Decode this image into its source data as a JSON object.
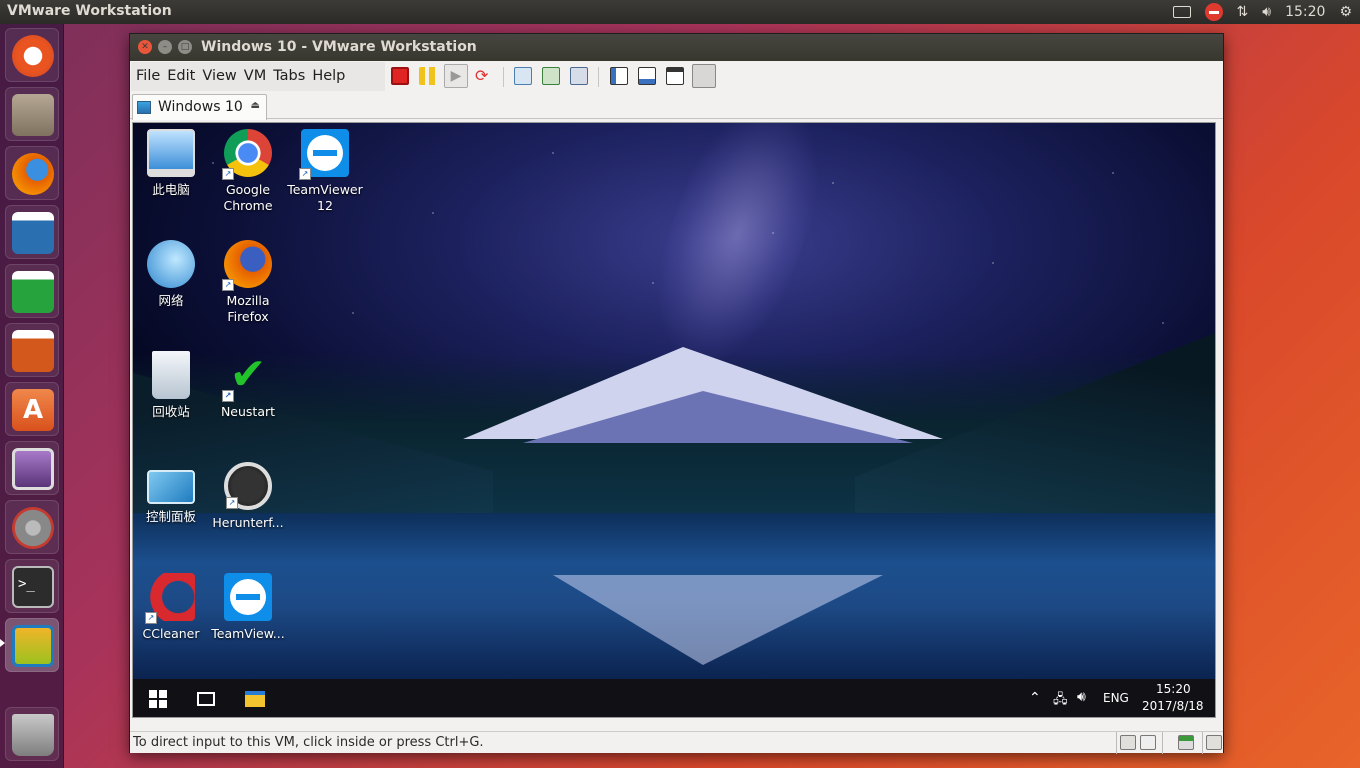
{
  "topbar": {
    "app_title": "VMware Workstation",
    "clock": "15:20",
    "icons": [
      "keyboard-layout-icon",
      "no-entry-icon",
      "network-arrows-icon",
      "volume-icon",
      "gear-icon"
    ]
  },
  "launcher": {
    "items": [
      {
        "name": "ubuntu-dash",
        "color": "#e95420"
      },
      {
        "name": "files",
        "color": "#9a8a76"
      },
      {
        "name": "firefox",
        "color": "#e66000"
      },
      {
        "name": "libreoffice-writer",
        "color": "#2a6fb0"
      },
      {
        "name": "libreoffice-calc",
        "color": "#27a33d"
      },
      {
        "name": "libreoffice-impress",
        "color": "#d2581b"
      },
      {
        "name": "ubuntu-software",
        "color": "#e76d2e"
      },
      {
        "name": "remote-desktop",
        "color": "#7b4f9e"
      },
      {
        "name": "system-settings",
        "color": "#c53b2f"
      },
      {
        "name": "terminal",
        "color": "#2c2c2c"
      },
      {
        "name": "vmware-workstation",
        "color": "#f0b429"
      },
      {
        "name": "trash",
        "color": "#8a8a8a"
      }
    ]
  },
  "window": {
    "title": "Windows 10 - VMware Workstation",
    "menus": [
      "File",
      "Edit",
      "View",
      "VM",
      "Tabs",
      "Help"
    ],
    "tab_label": "Windows 10",
    "status_message": "To direct input to this VM, click inside or press Ctrl+G."
  },
  "guest": {
    "desktop_icons": [
      {
        "label": "此电脑",
        "icon": "this-pc-icon"
      },
      {
        "label": "Google Chrome",
        "icon": "chrome-icon"
      },
      {
        "label": "TeamViewer 12",
        "icon": "teamviewer-icon"
      },
      {
        "label": "网络",
        "icon": "network-globe-icon"
      },
      {
        "label": "Mozilla Firefox",
        "icon": "firefox-icon"
      },
      {
        "label": "回收站",
        "icon": "recycle-bin-icon"
      },
      {
        "label": "Neustart",
        "icon": "checkmark-icon"
      },
      {
        "label": "控制面板",
        "icon": "control-panel-icon"
      },
      {
        "label": "Herunterf...",
        "icon": "clock-icon"
      },
      {
        "label": "CCleaner",
        "icon": "ccleaner-icon"
      },
      {
        "label": "TeamView...",
        "icon": "teamviewer-icon"
      }
    ],
    "taskbar": {
      "language": "ENG",
      "time": "15:20",
      "date": "2017/8/18"
    }
  }
}
